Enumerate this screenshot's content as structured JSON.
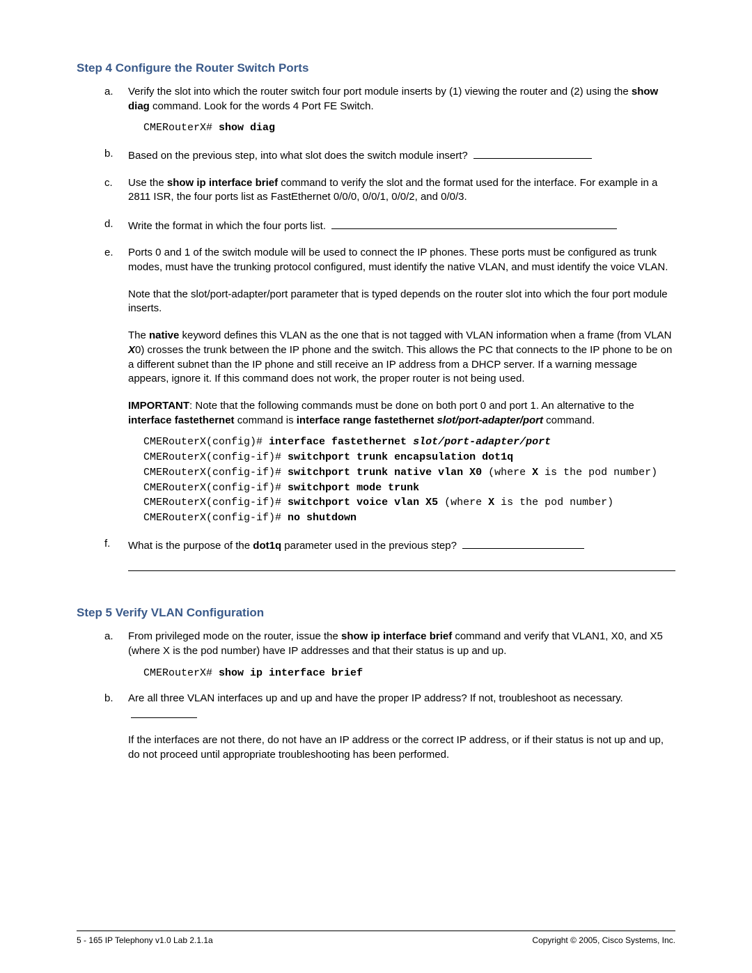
{
  "step4": {
    "heading": "Step 4 Configure the Router Switch Ports",
    "a": {
      "pre": "Verify the slot into which the router switch four port module inserts by (1) viewing the router and (2) using the ",
      "cmd": "show diag",
      "post": " command. Look for the words 4 Port FE Switch.",
      "code_prompt": "CMERouterX# ",
      "code_cmd": "show diag"
    },
    "b": {
      "text": "Based on the previous step, into what slot does the switch module insert? "
    },
    "c": {
      "pre": "Use the ",
      "cmd": "show ip interface brief",
      "post": " command to verify the slot and the format used for the interface. For example in a 2811 ISR, the four ports list as FastEthernet 0/0/0, 0/0/1, 0/0/2, and 0/0/3."
    },
    "d": {
      "text": "Write the format in which the four ports list. "
    },
    "e": {
      "p1": "Ports 0 and 1 of the switch module will be used to connect the IP phones. These ports must be configured as trunk modes, must have the trunking protocol configured, must identify the native VLAN, and must identify the voice VLAN.",
      "p2": "Note that the slot/port-adapter/port parameter that is typed depends on the router slot into which the four port module inserts.",
      "p3_pre": "The ",
      "p3_kw1": "native",
      "p3_mid": " keyword defines this VLAN as the one that is not tagged with VLAN information when a frame (from VLAN ",
      "p3_kw2": "X",
      "p3_post": "0) crosses the trunk between the IP phone and the switch. This allows the PC that connects to the IP phone to be on a different subnet than the IP phone and still receive an IP address from a DHCP server. If a warning message appears, ignore it. If this command does not work, the proper router is not being used.",
      "p4_imp": "IMPORTANT",
      "p4_a": ": Note that the following commands must be done on both port 0 and port 1. An alternative to the ",
      "p4_b": "interface fastethernet",
      "p4_c": " command is ",
      "p4_d": "interface range fastethernet ",
      "p4_e": "slot/port-adapter/port",
      "p4_f": " command.",
      "code": {
        "l1p": "CMERouterX(config)# ",
        "l1c": "interface fastethernet ",
        "l1i": "slot/port-adapter/port",
        "l2p": "CMERouterX(config-if)# ",
        "l2c": "switchport trunk encapsulation dot1q",
        "l3p": "CMERouterX(config-if)# ",
        "l3c": "switchport trunk native vlan X0",
        "l3t1": " (where ",
        "l3b": "X",
        "l3t2": " is the pod number)",
        "l4p": "CMERouterX(config-if)# ",
        "l4c": "switchport mode trunk",
        "l5p": "CMERouterX(config-if)# ",
        "l5c": "switchport voice vlan X5",
        "l5t1": " (where ",
        "l5b": "X",
        "l5t2": " is the pod number)",
        "l6p": "CMERouterX(config-if)# ",
        "l6c": "no shutdown"
      }
    },
    "f": {
      "pre": "What is the purpose of the ",
      "kw": "dot1q",
      "post": " parameter used in the previous step? "
    }
  },
  "step5": {
    "heading": "Step 5 Verify VLAN Configuration",
    "a": {
      "pre": "From privileged mode on the router, issue the ",
      "cmd": "show ip interface brief",
      "post": " command and verify that VLAN1, X0, and X5 (where X is the pod number) have IP addresses and that their status is up and up.",
      "code_prompt": "CMERouterX# ",
      "code_cmd": "show ip interface brief"
    },
    "b": {
      "p1": "Are all three VLAN interfaces up and up and have the proper IP address? If not, troubleshoot as necessary. ",
      "p2": "If the interfaces are not there, do not have an IP address or the correct IP address, or if their status is not up and up, do not proceed until appropriate troubleshooting has been performed."
    }
  },
  "footer": {
    "left": "5 - 165    IP Telephony v1.0   Lab 2.1.1a",
    "right": "Copyright © 2005, Cisco Systems, Inc."
  }
}
